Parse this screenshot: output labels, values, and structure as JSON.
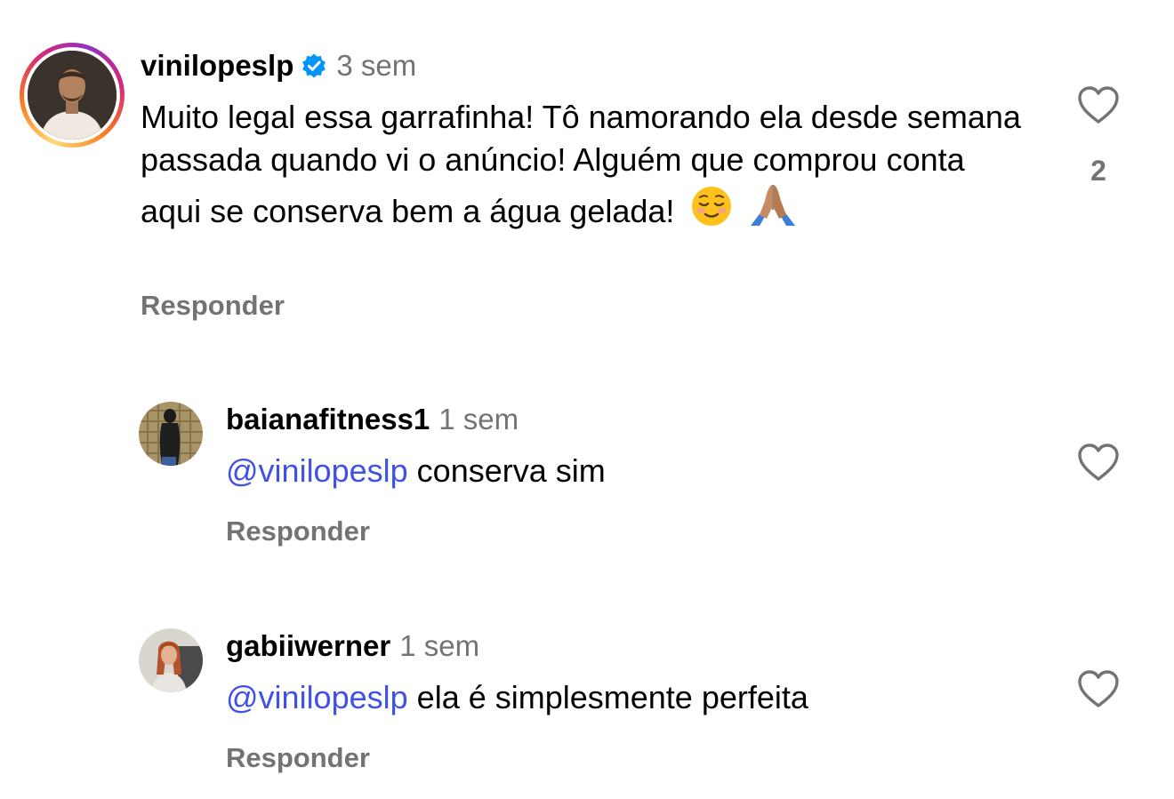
{
  "comments": [
    {
      "username": "vinilopeslp",
      "time": "3 sem",
      "verified": true,
      "text": "Muito legal essa garrafinha! Tô namorando ela desde semana passada quando vi o anúncio! Alguém que comprou conta aqui se conserva bem a água gelada!",
      "emojis": [
        "☺️",
        "🙏🏽"
      ],
      "reply_label": "Responder",
      "like_count": "2"
    },
    {
      "username": "baianafitness1",
      "time": "1 sem",
      "mention": "@vinilopeslp",
      "text": "conserva sim",
      "reply_label": "Responder"
    },
    {
      "username": "gabiiwerner",
      "time": "1 sem",
      "mention": "@vinilopeslp",
      "text": "ela é simplesmente perfeita",
      "reply_label": "Responder"
    }
  ],
  "colors": {
    "mention": "#3f51e6",
    "secondary_text": "#737373",
    "verified_badge": "#0095f6"
  },
  "icons": [
    "verified-badge-icon",
    "heart-outline-icon"
  ]
}
